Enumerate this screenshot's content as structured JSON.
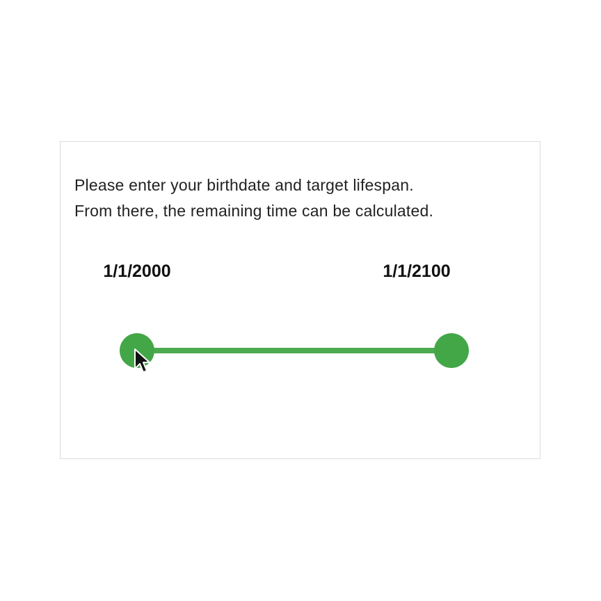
{
  "instructions": {
    "line1": "Please enter your birthdate and target lifespan.",
    "line2": "From there, the remaining time can be calculated."
  },
  "range": {
    "start_label": "1/1/2000",
    "end_label": "1/1/2100",
    "start_fraction": 0,
    "end_fraction": 1,
    "color": "#43a747"
  },
  "cursor": {
    "icon": "arrow-pointer-icon"
  }
}
